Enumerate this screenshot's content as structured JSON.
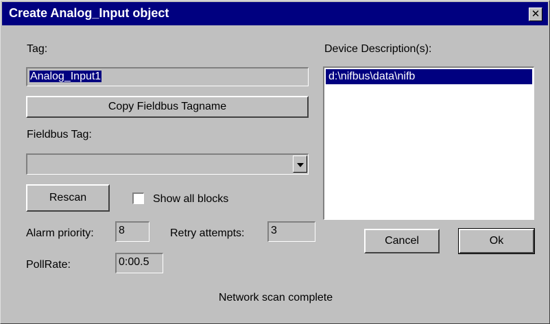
{
  "window": {
    "title": "Create Analog_Input object",
    "close_glyph": "✕"
  },
  "tag": {
    "label": "Tag:",
    "value": "Analog_Input1"
  },
  "copy_button": {
    "label": "Copy Fieldbus Tagname"
  },
  "fieldbus_tag": {
    "label": "Fieldbus Tag:",
    "value": ""
  },
  "rescan_button": {
    "label": "Rescan"
  },
  "show_all_blocks": {
    "label": "Show all blocks",
    "checked": false
  },
  "alarm_priority": {
    "label": "Alarm priority:",
    "value": "8"
  },
  "retry_attempts": {
    "label": "Retry attempts:",
    "value": "3"
  },
  "poll_rate": {
    "label": "PollRate:",
    "value": "0:00.5"
  },
  "device_descriptions": {
    "label": "Device Description(s):",
    "items": [
      "d:\\nifbus\\data\\nifb"
    ]
  },
  "cancel_button": {
    "label": "Cancel"
  },
  "ok_button": {
    "label": "Ok"
  },
  "status": {
    "text": "Network scan complete"
  },
  "colors": {
    "title_bar": "#000080",
    "dialog_face": "#c0c0c0",
    "selection": "#000080"
  }
}
